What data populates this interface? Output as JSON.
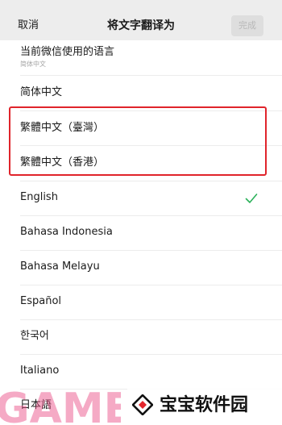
{
  "nav": {
    "cancel_label": "取消",
    "title": "将文字翻译为",
    "done_label": "完成"
  },
  "languages": [
    {
      "label": "当前微信使用的语言",
      "sub": "简体中文"
    },
    {
      "label": "简体中文"
    },
    {
      "label": "繁體中文（臺灣）"
    },
    {
      "label": "繁體中文（香港）"
    },
    {
      "label": "English",
      "selected": true
    },
    {
      "label": "Bahasa Indonesia"
    },
    {
      "label": "Bahasa Melayu"
    },
    {
      "label": "Español"
    },
    {
      "label": "한국어"
    },
    {
      "label": "Italiano"
    },
    {
      "label": "日本語"
    }
  ],
  "colors": {
    "accent_check": "#2bb15a",
    "highlight_border": "#e0242b",
    "watermark_pink": "#e9457f"
  },
  "watermark": {
    "game_text": "GAME",
    "brand_name": "宝宝软件园",
    "logo_icon": "diamond-logo-icon"
  }
}
